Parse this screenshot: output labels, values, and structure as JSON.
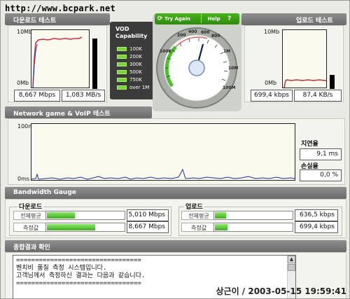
{
  "header": {
    "url": "http://www.bcpark.net"
  },
  "download": {
    "title": "다운로드 테스트",
    "y_top": "10Mb",
    "y_bottom": "0Mb",
    "speed_mbps": "8,667 Mbps",
    "speed_bytes": "1,083 MB/s"
  },
  "upload": {
    "title": "업로드 테스트",
    "y_top": "10Mb",
    "y_bottom": "0Mb",
    "speed_kbps": "699,4 kbps",
    "speed_bytes": "87,4 KB/s"
  },
  "vod": {
    "title_line1": "VOD",
    "title_line2": "Capability",
    "levels": [
      "100K",
      "200K",
      "300K",
      "500K",
      "750K",
      "over 1M"
    ]
  },
  "gauge": {
    "try_again": "Try Again",
    "help": "Help",
    "help_icon": "?",
    "ticks": [
      "100K",
      "200",
      "400",
      "600",
      "800",
      "1M",
      "10M",
      "100M"
    ]
  },
  "network": {
    "title": "Network game & VoIP 테스트",
    "y_top": "100m",
    "y_bottom": "0ms",
    "latency_label": "지연율",
    "latency_value": "9,1 ms",
    "loss_label": "손실율",
    "loss_value": "0,0 %"
  },
  "bandwidth": {
    "title": "Bandwidth Gauge",
    "download": {
      "label": "다운로드",
      "rows": [
        {
          "label": "전체평균",
          "value": "5,010 Mbps",
          "fraction": 0.36
        },
        {
          "label": "측정값",
          "value": "8,667 Mbps",
          "fraction": 0.62
        }
      ]
    },
    "upload": {
      "label": "업로드",
      "rows": [
        {
          "label": "전체평균",
          "value": "636,5 kbps",
          "fraction": 0.14
        },
        {
          "label": "측정값",
          "value": "699,4 kbps",
          "fraction": 0.16
        }
      ]
    }
  },
  "result": {
    "title": "종합결과 확인",
    "lines": [
      "=================================",
      "벤치비 품질 측정 시스템입니다.",
      "고객님께서 측정하신 결과는 다음과 같습니다.",
      "================================="
    ]
  },
  "footer": {
    "stamp": "상근이 / 2003-05-15 19:59:41"
  },
  "colors": {
    "accent": "#3fae1f",
    "download_line": "#c0303a",
    "upload_line": "#c0303a",
    "latency_line": "#1e2fa0"
  }
}
